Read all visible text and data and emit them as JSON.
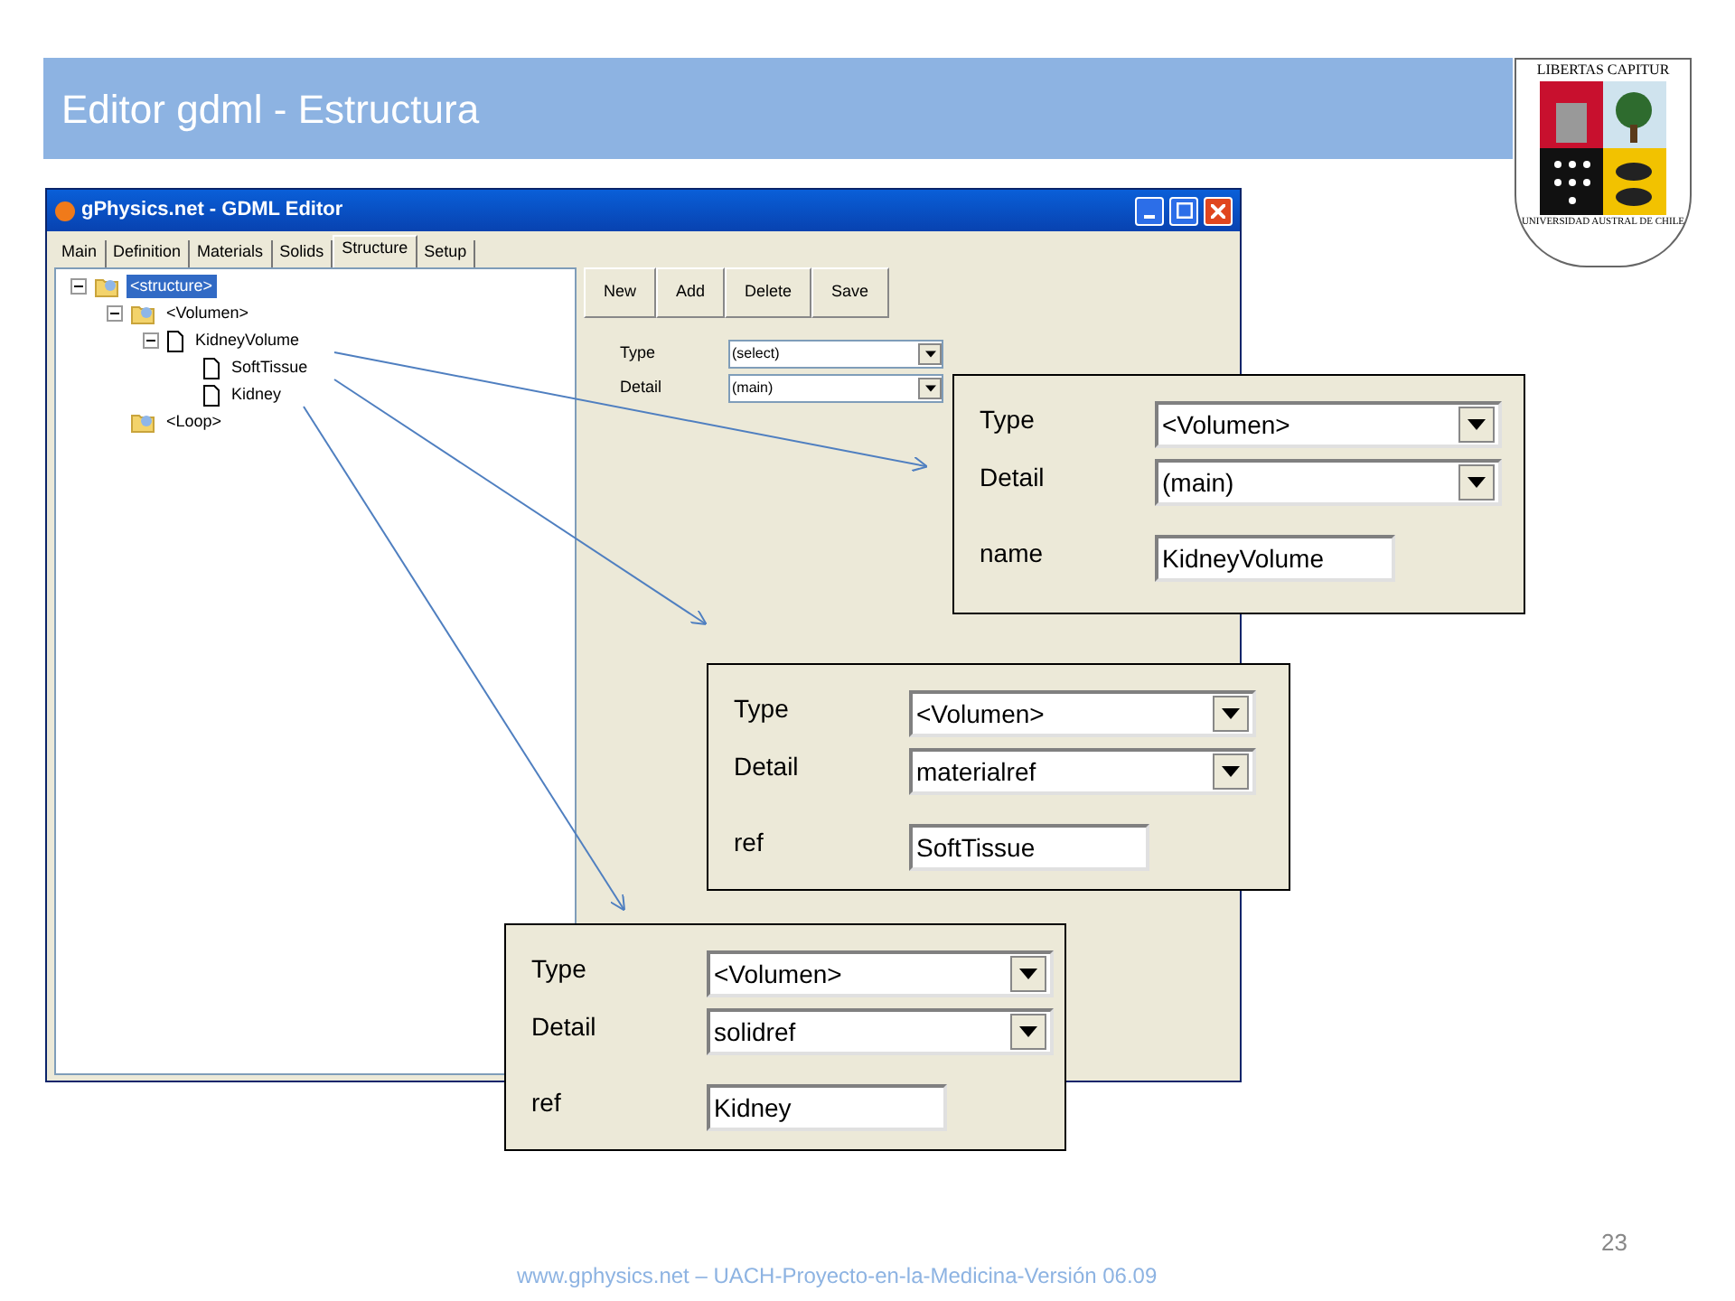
{
  "slide": {
    "title": "Editor gdml - Estructura",
    "page_number": "23",
    "footer": "www.gphysics.net – UACH-Proyecto-en-la-Medicina-Versión 06.09"
  },
  "logo": {
    "motto": "LIBERTAS CAPITUR",
    "name": "UNIVERSIDAD AUSTRAL DE CHILE"
  },
  "window": {
    "title": "gPhysics.net - GDML Editor",
    "tabs": [
      {
        "label": "Main",
        "selected": false
      },
      {
        "label": "Definition",
        "selected": false
      },
      {
        "label": "Materials",
        "selected": false
      },
      {
        "label": "Solids",
        "selected": false
      },
      {
        "label": "Structure",
        "selected": true
      },
      {
        "label": "Setup",
        "selected": false
      }
    ],
    "tree": [
      {
        "label": "<structure>",
        "kind": "folder",
        "selected": true,
        "expanded": true,
        "children": [
          {
            "label": "<Volumen>",
            "kind": "folder",
            "selected": false,
            "expanded": true,
            "children": [
              {
                "label": "KidneyVolume",
                "kind": "file",
                "selected": false,
                "expanded": true,
                "children": [
                  {
                    "label": "SoftTissue",
                    "kind": "file",
                    "selected": false
                  },
                  {
                    "label": "Kidney",
                    "kind": "file",
                    "selected": false
                  }
                ]
              }
            ]
          },
          {
            "label": "<Loop>",
            "kind": "folder",
            "selected": false
          }
        ]
      }
    ],
    "toolbar": [
      "New",
      "Add",
      "Delete",
      "Save"
    ],
    "fields": [
      {
        "label": "Type",
        "value": "(select)"
      },
      {
        "label": "Detail",
        "value": "(main)"
      }
    ]
  },
  "callouts": [
    {
      "fields": [
        {
          "label": "Type",
          "value": "<Volumen>",
          "kind": "select"
        },
        {
          "label": "Detail",
          "value": "(main)",
          "kind": "select"
        },
        {
          "label": "name",
          "value": "KidneyVolume",
          "kind": "text"
        }
      ]
    },
    {
      "fields": [
        {
          "label": "Type",
          "value": "<Volumen>",
          "kind": "select"
        },
        {
          "label": "Detail",
          "value": "materialref",
          "kind": "select"
        },
        {
          "label": "ref",
          "value": "SoftTissue",
          "kind": "text"
        }
      ]
    },
    {
      "fields": [
        {
          "label": "Type",
          "value": "<Volumen>",
          "kind": "select"
        },
        {
          "label": "Detail",
          "value": "solidref",
          "kind": "select"
        },
        {
          "label": "ref",
          "value": "Kidney",
          "kind": "text"
        }
      ]
    }
  ]
}
